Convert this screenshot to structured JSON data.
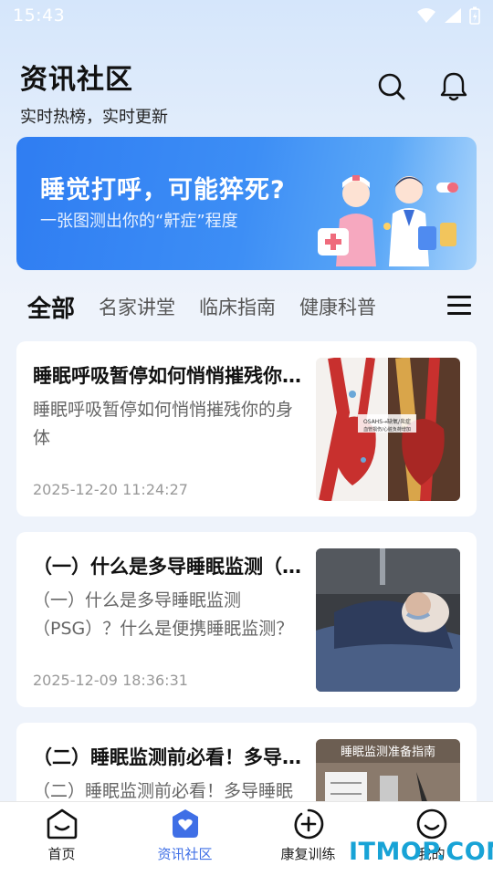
{
  "status_bar": {
    "time": "15:43"
  },
  "header": {
    "title": "资讯社区",
    "subtitle": "实时热榜，实时更新",
    "search_icon": "search-icon",
    "bell_icon": "bell-icon"
  },
  "banner": {
    "title": "睡觉打呼，可能猝死?",
    "subtitle": "一张图测出你的“鼾症”程度"
  },
  "tabs": [
    {
      "label": "全部",
      "active": true
    },
    {
      "label": "名家讲堂"
    },
    {
      "label": "临床指南"
    },
    {
      "label": "健康科普"
    }
  ],
  "articles": [
    {
      "title": "睡眠呼吸暂停如何悄悄摧残你的身体",
      "summary": "睡眠呼吸暂停如何悄悄摧残你的身体",
      "date": "2025-12-20 11:24:27",
      "thumb_caption": "OSAHS→缺氧/炎症 血管损伤/心脏负荷增加"
    },
    {
      "title": "（一）什么是多导睡眠监测（PSG）？",
      "summary": "（一）什么是多导睡眠监测（PSG）？什么是便携睡眠监测？",
      "date": "2025-12-09 18:36:31"
    },
    {
      "title": "（二）睡眠监测前必看！多导睡眠监测准备指南",
      "summary": "（二）睡眠监测前必看！多导睡眠监测准备指南",
      "thumb_caption": "睡眠监测准备指南"
    }
  ],
  "bottom_nav": [
    {
      "label": "首页"
    },
    {
      "label": "资讯社区",
      "active": true
    },
    {
      "label": "康复训练"
    },
    {
      "label": "我的"
    }
  ],
  "watermark": "ITMOP.COM",
  "colors": {
    "accent": "#3f6fe6",
    "banner": "#2f7df2",
    "watermark": "#18a3d6"
  }
}
